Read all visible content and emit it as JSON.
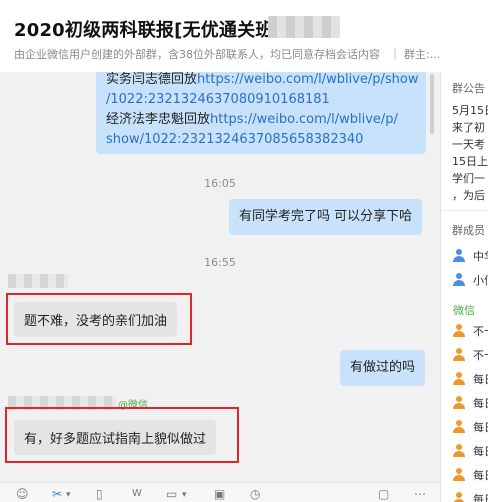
{
  "header": {
    "title": "2020初级两科联报[无优通关班",
    "subtitle": "由企业微信用户创建的外部群，含38位外部联系人，均已同意存档会话内容",
    "subtitle_extra": "｜ 群主:..."
  },
  "chat": {
    "link_message": {
      "line1": "实务闫志德回放",
      "line1_link": "https://weibo.com/l/wblive/p/show",
      "line2_link": "/1022:2321324637080910168181",
      "line3": "经济法李忠魁回放",
      "line3_link": "https://weibo.com/l/wblive/p/",
      "line4_link": "show/1022:2321324637085658382340"
    },
    "time1": "16:05",
    "msg_self_1": "有同学考完了吗  可以分享下哈",
    "time2": "16:55",
    "msg_other_1": "题不难，没考的亲们加油",
    "msg_self_2": "有做过的吗",
    "sender_tag": "@微信",
    "msg_other_2": "有，好多题应试指南上貌似做过"
  },
  "sidebar": {
    "notice_title": "群公告",
    "notice_lines": [
      "5月15日",
      "来了初",
      "一天考",
      "15日上",
      "学们一",
      "，为后"
    ],
    "members_title": "群成员",
    "members": [
      {
        "name": "中华",
        "color": "blue"
      },
      {
        "name": "小何",
        "color": "blue"
      }
    ],
    "wechat_label": "微信",
    "wechat_members": [
      {
        "name": "不卡"
      },
      {
        "name": "不卡"
      },
      {
        "name": "每日"
      },
      {
        "name": "每日"
      },
      {
        "name": "每日"
      },
      {
        "name": "每日"
      },
      {
        "name": "每日"
      },
      {
        "name": "每日"
      }
    ]
  },
  "toolbar": {
    "icons": [
      "emoji-icon",
      "scissors-icon",
      "file-icon",
      "word-doc-icon",
      "folder-icon",
      "image-icon",
      "history-icon",
      "video-icon",
      "more-icon"
    ]
  },
  "colors": {
    "self_bubble": "#c8e2fb",
    "other_bubble": "#e4e4e4",
    "link": "#2a6fc9",
    "highlight_box": "#e0262a",
    "wechat_green": "#4aa94a"
  }
}
